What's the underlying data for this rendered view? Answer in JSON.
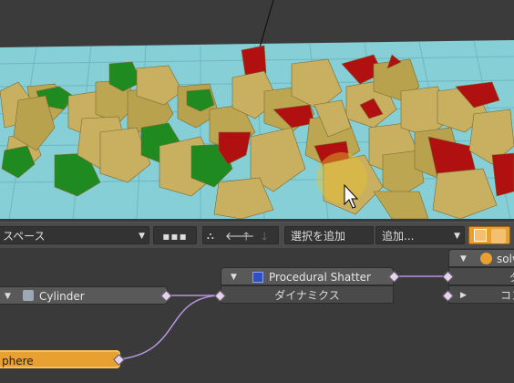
{
  "toolbar": {
    "space_dropdown": "スペース",
    "add_selected_button": "選択を追加",
    "add_dropdown": "追加..."
  },
  "nodes": {
    "procedural_shatter": {
      "title": "Procedural Shatter",
      "row": "ダイナミクス"
    },
    "cylinder": {
      "title": "Cylinder"
    },
    "sphere": {
      "title": "phere"
    },
    "solver": {
      "title": "solv",
      "row1": "ダ",
      "row2": "コン"
    }
  },
  "icons": {
    "dropdown": "triangle-down",
    "grid": "grid-icon",
    "arrows": [
      "hierarchy-icon",
      "arrow-left-icon",
      "arrow-up-icon",
      "arrow-down-icon"
    ]
  },
  "colors": {
    "gold": "#c8b060",
    "red": "#b01010",
    "green": "#1f8a1f",
    "floor": "#7fcad4",
    "wire": "#b895e0",
    "highlight": "#e8a030"
  }
}
